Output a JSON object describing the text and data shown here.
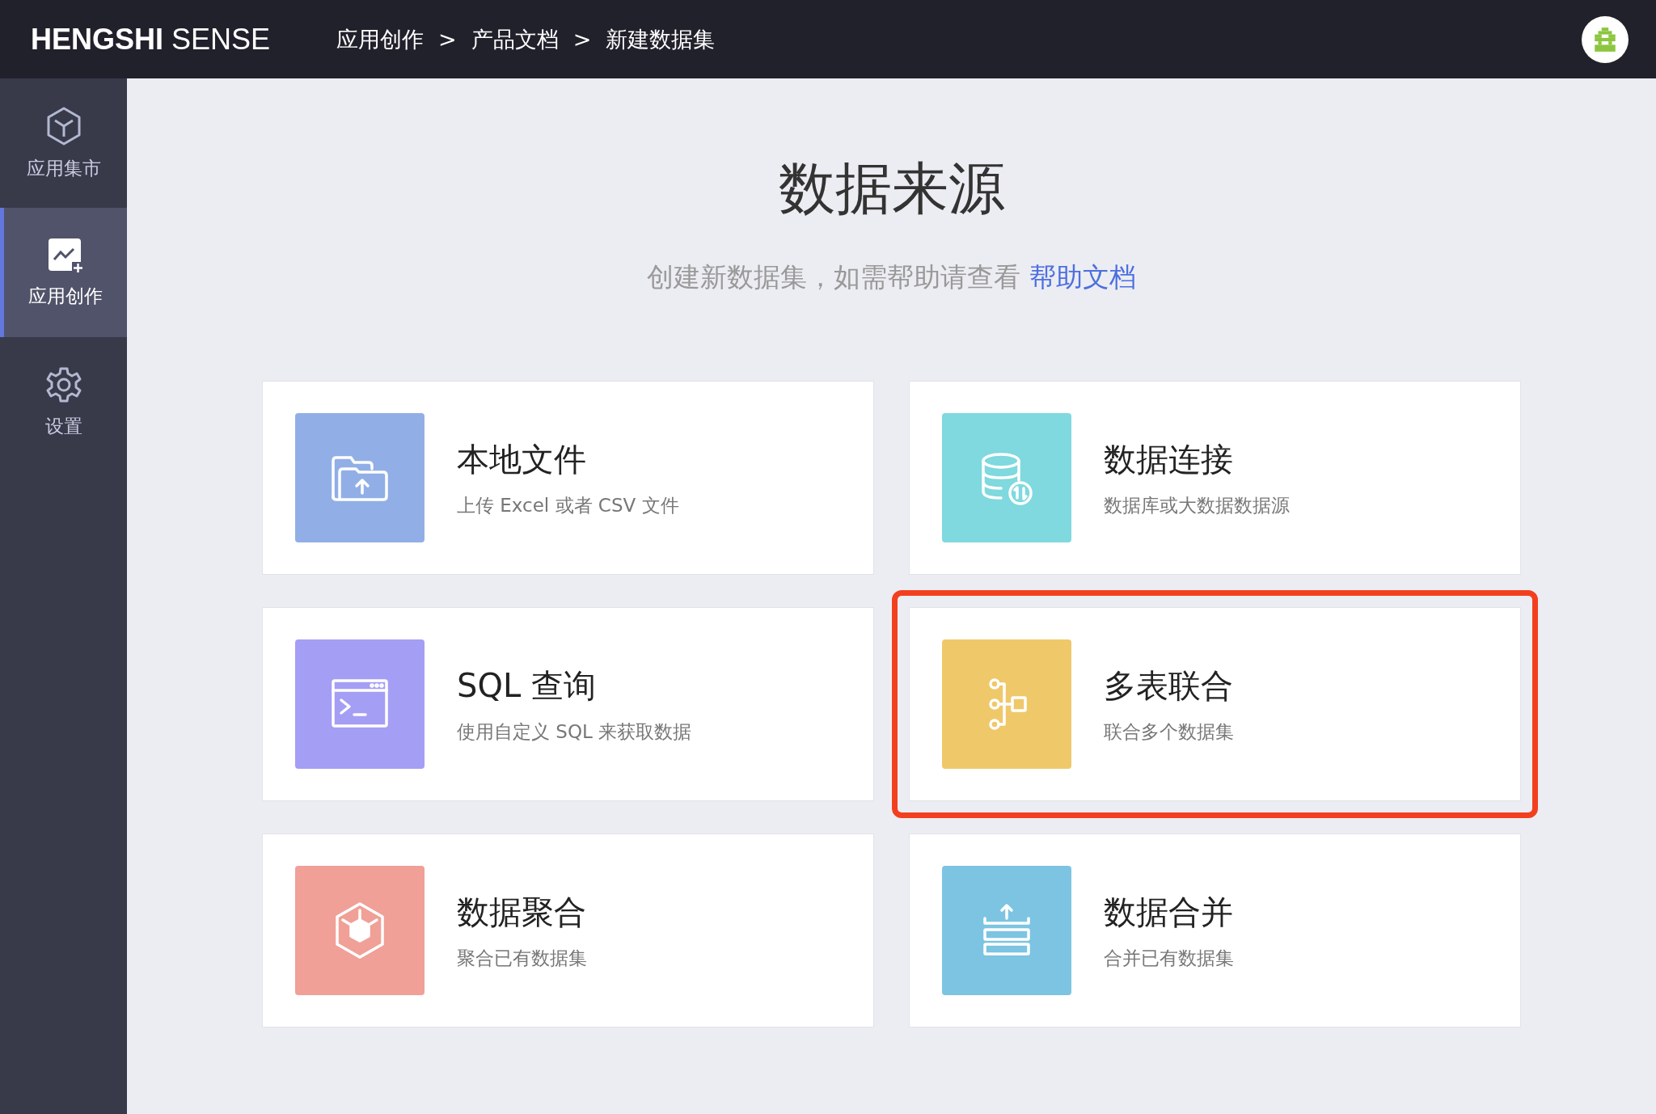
{
  "header": {
    "brand_bold": "HENGSHI",
    "brand_light": "SENSE",
    "breadcrumb": [
      "应用创作",
      "产品文档",
      "新建数据集"
    ],
    "separator": ">"
  },
  "sidebar": {
    "items": [
      {
        "label": "应用集市",
        "kind": "cube",
        "selected": false
      },
      {
        "label": "应用创作",
        "kind": "chart",
        "selected": true
      },
      {
        "label": "设置",
        "kind": "gear",
        "selected": false
      }
    ]
  },
  "main": {
    "title": "数据来源",
    "subtitle": "创建新数据集，如需帮助请查看",
    "help_link": "帮助文档",
    "cards": [
      {
        "title": "本地文件",
        "description": "上传 Excel 或者 CSV 文件",
        "kind": "folder",
        "color": "#91afe6",
        "highlighted": false
      },
      {
        "title": "数据连接",
        "description": "数据库或大数据数据源",
        "kind": "database",
        "color": "#7fd9de",
        "highlighted": false
      },
      {
        "title": "SQL 查询",
        "description": "使用自定义 SQL 来获取数据",
        "kind": "terminal",
        "color": "#a49ef5",
        "highlighted": false
      },
      {
        "title": "多表联合",
        "description": "联合多个数据集",
        "kind": "tree",
        "color": "#efc86a",
        "highlighted": true
      },
      {
        "title": "数据聚合",
        "description": "聚合已有数据集",
        "kind": "cube",
        "color": "#f0a097",
        "highlighted": false
      },
      {
        "title": "数据合并",
        "description": "合并已有数据集",
        "kind": "stack",
        "color": "#7cc4e2",
        "highlighted": false
      }
    ]
  }
}
